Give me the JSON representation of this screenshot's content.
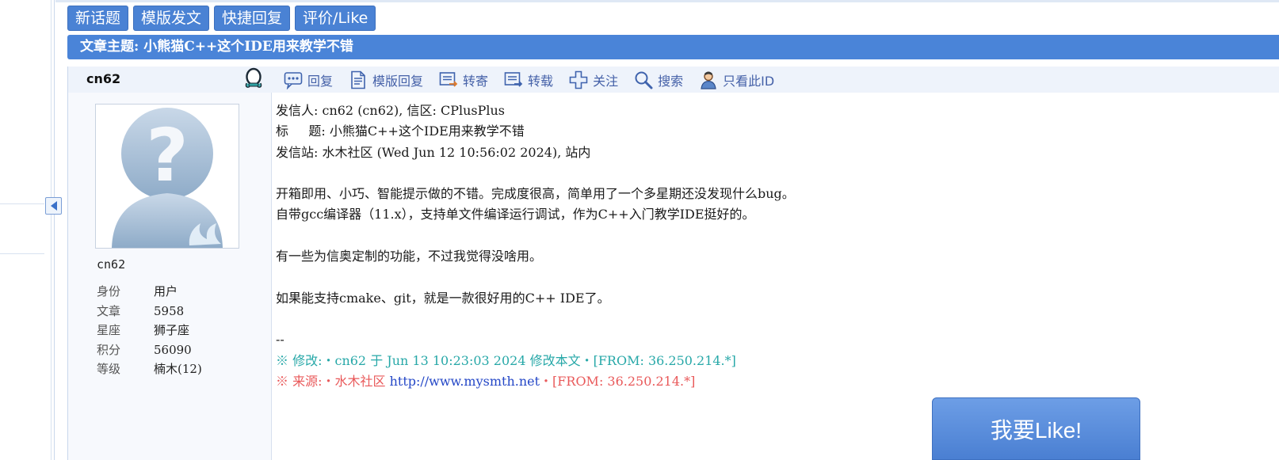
{
  "actions": {
    "new_topic": "新话题",
    "template_post": "模版发文",
    "quick_reply": "快捷回复",
    "rate_like": "评价/Like"
  },
  "thread": {
    "title": "文章主题: 小熊猫C++这个IDE用来教学不错"
  },
  "author": {
    "name": "cn62",
    "id": "cn62",
    "stats": [
      {
        "key": "身份",
        "value": "用户"
      },
      {
        "key": "文章",
        "value": "5958"
      },
      {
        "key": "星座",
        "value": "狮子座"
      },
      {
        "key": "积分",
        "value": "56090"
      },
      {
        "key": "等级",
        "value": "楠木(12)"
      }
    ]
  },
  "toolbar": {
    "reply": "回复",
    "template_reply": "模版回复",
    "forward": "转寄",
    "repost": "转载",
    "follow": "关注",
    "search": "搜索",
    "only_this_id": "只看此ID"
  },
  "post": {
    "sender": "发信人: cn62 (cn62), 信区: CPlusPlus",
    "subject": "标     题: 小熊猫C++这个IDE用来教学不错",
    "station": "发信站: 水木社区 (Wed Jun 12 10:56:02 2024), 站内",
    "body1": "开箱即用、小巧、智能提示做的不错。完成度很高，简单用了一个多星期还没发现什么bug。",
    "body2": "自带gcc编译器（11.x），支持单文件编译运行调试，作为C++入门教学IDE挺好的。",
    "body3": "有一些为信奥定制的功能，不过我觉得没啥用。",
    "body4": "如果能支持cmake、git，就是一款很好用的C++ IDE了。",
    "sig_sep": "--",
    "modified": "※ 修改:・cn62 于 Jun 13 10:23:03 2024 修改本文・[FROM: 36.250.214.*]",
    "source_prefix": "※ 来源:・水木社区 ",
    "source_link": "http://www.mysmth.net",
    "source_suffix": "・[FROM: 36.250.214.*]"
  },
  "like_button": "我要Like!",
  "colors": {
    "accent_blue": "#4a84d8",
    "modified_teal": "#27a8a8",
    "source_red": "#e9595a",
    "link_blue": "#2447c7"
  },
  "icons": [
    "reply-icon",
    "template-reply-icon",
    "forward-icon",
    "repost-icon",
    "follow-icon",
    "search-icon",
    "only-id-icon",
    "qq-icon",
    "collapse-arrow-icon"
  ]
}
